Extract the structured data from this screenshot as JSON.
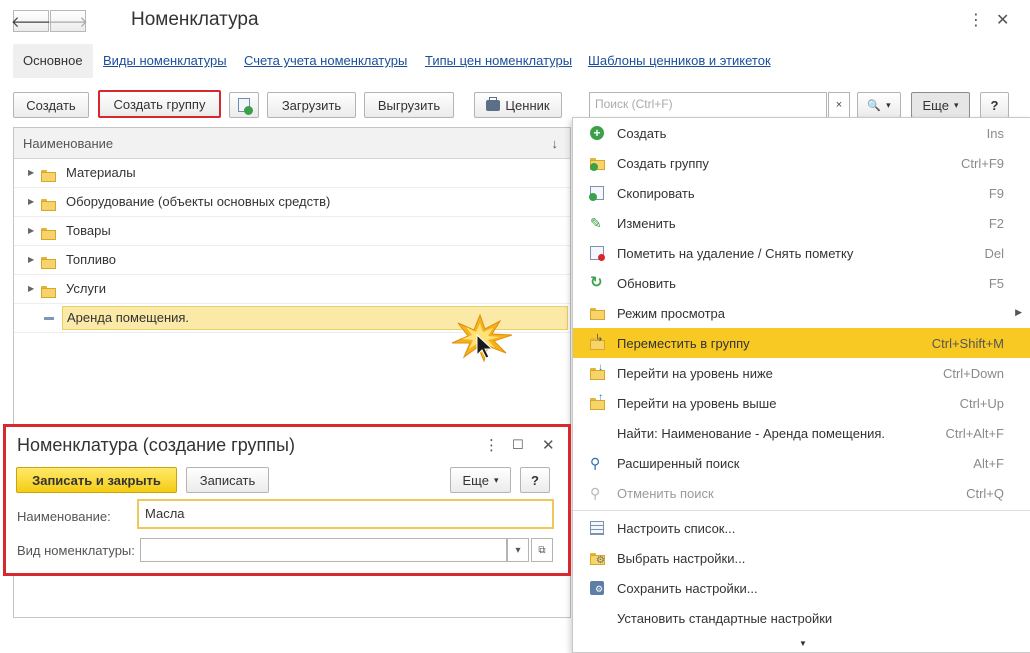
{
  "window": {
    "title": "Номенклатура",
    "back_icon": "arrow-left-icon",
    "forward_icon": "arrow-right-icon",
    "back_glyph": "🡐",
    "forward_glyph": "🡒",
    "more_glyph": "⋮",
    "close_glyph": "✕"
  },
  "tabs": [
    {
      "label": "Основное",
      "active": true
    },
    {
      "label": "Виды номенклатуры",
      "active": false
    },
    {
      "label": "Счета учета номенклатуры",
      "active": false
    },
    {
      "label": "Типы цен номенклатуры",
      "active": false
    },
    {
      "label": "Шаблоны ценников и этикеток",
      "active": false
    }
  ],
  "toolbar": {
    "create": "Создать",
    "create_group": "Создать группу",
    "load": "Загрузить",
    "unload": "Выгрузить",
    "price_tag": "Ценник",
    "more": "Еще",
    "help": "?",
    "dropdown_glyph": "▾"
  },
  "search": {
    "placeholder": "Поиск (Ctrl+F)",
    "clear_glyph": "×",
    "find_glyph": "🔍"
  },
  "list": {
    "column_header": "Наименование",
    "sort_glyph": "↓",
    "rows": [
      {
        "label": "Материалы",
        "type": "group"
      },
      {
        "label": "Оборудование (объекты основных средств)",
        "type": "group"
      },
      {
        "label": "Товары",
        "type": "group"
      },
      {
        "label": "Топливо",
        "type": "group"
      },
      {
        "label": "Услуги",
        "type": "group"
      },
      {
        "label": "Аренда помещения.",
        "type": "item",
        "selected": true
      }
    ]
  },
  "menu": {
    "items": [
      {
        "label": "Создать",
        "shortcut": "Ins",
        "icon": "plus-circle-icon"
      },
      {
        "label": "Создать группу",
        "shortcut": "Ctrl+F9",
        "icon": "folder-add-icon"
      },
      {
        "label": "Скопировать",
        "shortcut": "F9",
        "icon": "copy-icon"
      },
      {
        "label": "Изменить",
        "shortcut": "F2",
        "icon": "pencil-icon"
      },
      {
        "label": "Пометить на удаление / Снять пометку",
        "shortcut": "Del",
        "icon": "mark-delete-icon"
      },
      {
        "label": "Обновить",
        "shortcut": "F5",
        "icon": "refresh-icon"
      },
      {
        "label": "Режим просмотра",
        "shortcut": "",
        "icon": "view-mode-icon",
        "submenu": true
      },
      {
        "label": "Переместить в группу",
        "shortcut": "Ctrl+Shift+M",
        "icon": "move-to-group-icon",
        "highlighted": true
      },
      {
        "label": "Перейти на уровень ниже",
        "shortcut": "Ctrl+Down",
        "icon": "level-down-icon"
      },
      {
        "label": "Перейти на уровень выше",
        "shortcut": "Ctrl+Up",
        "icon": "level-up-icon"
      },
      {
        "label": "Найти: Наименование - Аренда помещения.",
        "shortcut": "Ctrl+Alt+F",
        "icon": ""
      },
      {
        "label": "Расширенный поиск",
        "shortcut": "Alt+F",
        "icon": "advanced-search-icon"
      },
      {
        "label": "Отменить поиск",
        "shortcut": "Ctrl+Q",
        "icon": "cancel-search-icon",
        "disabled": true
      },
      {
        "separator": true
      },
      {
        "label": "Настроить список...",
        "shortcut": "",
        "icon": "list-settings-icon"
      },
      {
        "label": "Выбрать настройки...",
        "shortcut": "",
        "icon": "choose-settings-icon"
      },
      {
        "label": "Сохранить настройки...",
        "shortcut": "",
        "icon": "save-settings-icon"
      },
      {
        "label": "Установить стандартные настройки",
        "shortcut": "",
        "icon": ""
      }
    ],
    "submenu_glyph": "▶",
    "scroll_glyph": "▼"
  },
  "dialog": {
    "title": "Номенклатура (создание группы)",
    "save_close": "Записать и закрыть",
    "save": "Записать",
    "more": "Еще",
    "help": "?",
    "name_label": "Наименование:",
    "name_value": "Масла",
    "kind_label": "Вид номенклатуры:",
    "kind_value": "",
    "maximize_glyph": "☐",
    "open_glyph": "⧉"
  },
  "colors": {
    "accent_yellow": "#f8c923",
    "highlight_red": "#d7282f",
    "link_blue": "#1b4f9a",
    "selection": "#fbe9a8"
  }
}
